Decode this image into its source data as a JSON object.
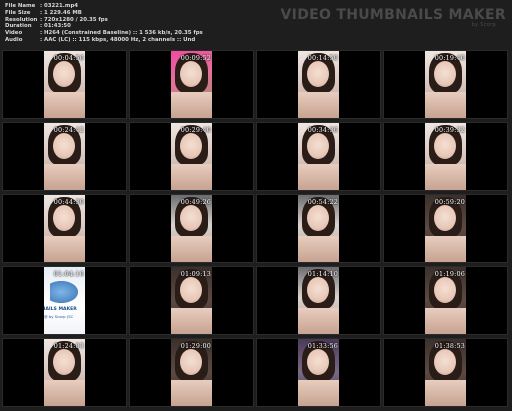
{
  "info": [
    {
      "label": "File Name",
      "value": ":  03221.mp4"
    },
    {
      "label": "File Size",
      "value": ":  1 229.46 MB"
    },
    {
      "label": "Resolution",
      "value": ":  720x1280 / 20.35 fps"
    },
    {
      "label": "Duration",
      "value": ":  01:43:50"
    },
    {
      "label": "Video",
      "value": ":  H264 (Constrained Baseline) :: 1 536 kb/s, 20.35 fps"
    },
    {
      "label": "Audio",
      "value": ":  AAC (LC) :: 115 kbps, 48000 Hz, 2 channels :: Und"
    }
  ],
  "brand": {
    "title": "VIDEO THUMBNAILS MAKER",
    "subtitle": "by Scorp"
  },
  "thumbnails": [
    {
      "time": "00:04:56",
      "style": "bright"
    },
    {
      "time": "00:09:52",
      "style": "pink"
    },
    {
      "time": "00:14:50",
      "style": "bright"
    },
    {
      "time": "00:19:46",
      "style": "bright"
    },
    {
      "time": "00:24:42",
      "style": "bright"
    },
    {
      "time": "00:29:40",
      "style": "bright"
    },
    {
      "time": "00:34:36",
      "style": "bright"
    },
    {
      "time": "00:39:32",
      "style": "bright"
    },
    {
      "time": "00:44:30",
      "style": "bright"
    },
    {
      "time": "00:49:26",
      "style": "bed"
    },
    {
      "time": "00:54:22",
      "style": "bed"
    },
    {
      "time": "00:59:20",
      "style": "dark"
    },
    {
      "time": "01:04:16",
      "style": "logo"
    },
    {
      "time": "01:09:13",
      "style": "dark"
    },
    {
      "time": "01:14:10",
      "style": "bed"
    },
    {
      "time": "01:19:06",
      "style": "dark"
    },
    {
      "time": "01:24:03",
      "style": "bright"
    },
    {
      "time": "01:29:00",
      "style": "dark"
    },
    {
      "time": "01:33:56",
      "style": "purple"
    },
    {
      "time": "01:38:53",
      "style": "dark"
    }
  ],
  "logo_overlay": {
    "text": "BNAILS MAKER",
    "sub": "R @ by Scorp (SC"
  }
}
